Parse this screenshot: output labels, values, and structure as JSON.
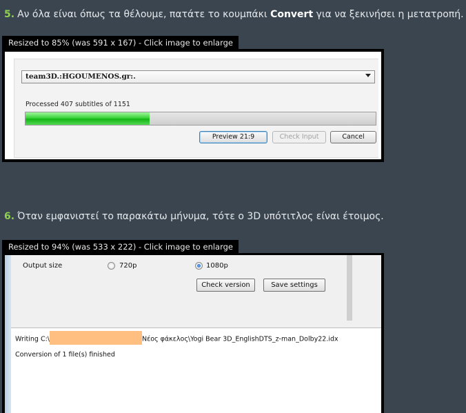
{
  "step5": {
    "number": "5.",
    "text_before": "Αν όλα είναι όπως τα θέλουμε, πατάτε το κουμπάκι ",
    "bold": "Convert",
    "text_after": " για να ξεκινήσει η μετατροπή."
  },
  "image1": {
    "resize_notice": "Resized to 85% (was 591 x 167) - Click image to enlarge",
    "combo_value": "team3D.:HGOUMENOS.gr:.",
    "processed_text": "Processed 407 subtitles of 1151",
    "progress": {
      "processed": 407,
      "total": 1151
    },
    "buttons": {
      "preview": "Preview 21:9",
      "check_input": "Check Input",
      "cancel": "Cancel"
    }
  },
  "step6": {
    "number": "6.",
    "text": "Όταν εμφανιστεί το παρακάτω μήνυμα, τότε ο 3D υπότιτλος είναι έτοιμος."
  },
  "image2": {
    "resize_notice": "Resized to 94% (was 533 x 222) - Click image to enlarge",
    "output_size_label": "Output size",
    "options": [
      {
        "label": "720p",
        "selected": false
      },
      {
        "label": "1080p",
        "selected": true
      }
    ],
    "buttons": {
      "check_version": "Check version",
      "save_settings": "Save settings"
    },
    "log": {
      "writing_prefix": "Writing C:\\",
      "writing_suffix": "Νέος φάκελος\\Yogi Bear 3D_EnglishDTS_z-man_Dolby22.idx",
      "finished": "Conversion of 1 file(s) finished"
    }
  }
}
